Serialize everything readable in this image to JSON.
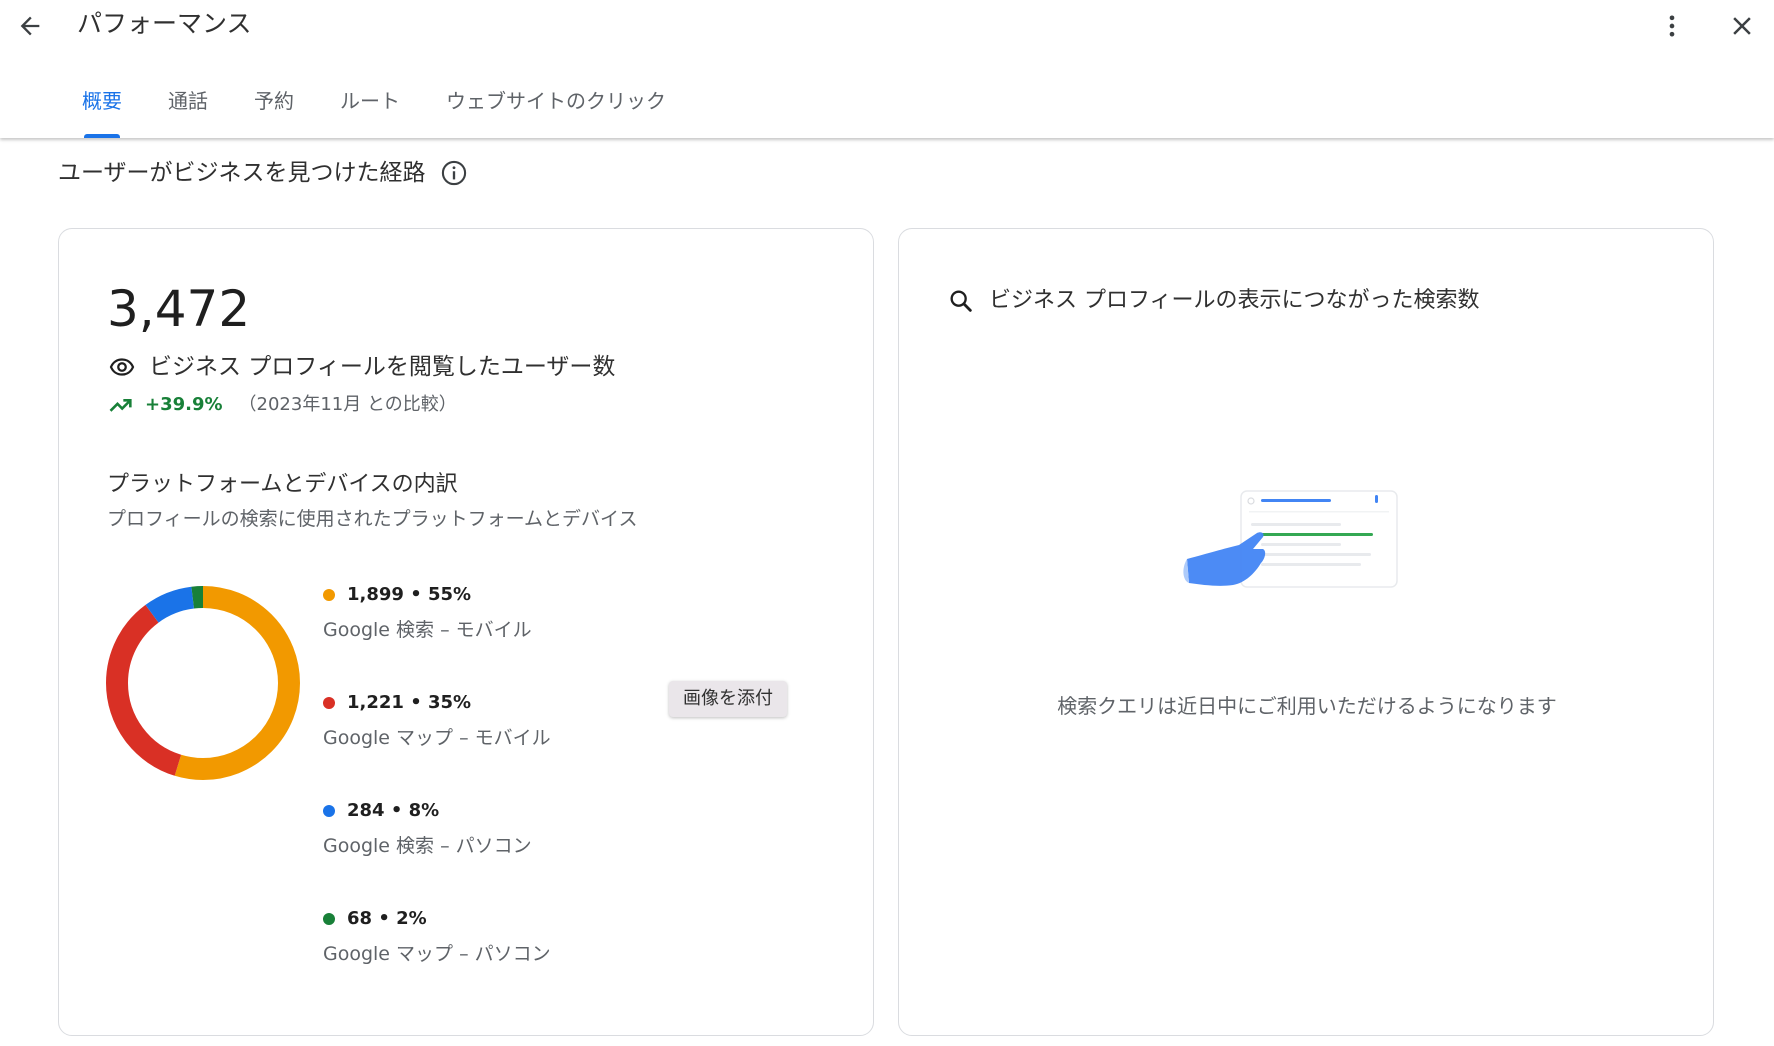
{
  "header": {
    "title": "パフォーマンス",
    "icons": {
      "back": "arrow-back-icon",
      "more": "more-vert-icon",
      "close": "close-icon"
    }
  },
  "tabs": [
    {
      "label": "概要",
      "active": true
    },
    {
      "label": "通話",
      "active": false
    },
    {
      "label": "予約",
      "active": false
    },
    {
      "label": "ルート",
      "active": false
    },
    {
      "label": "ウェブサイトのクリック",
      "active": false
    }
  ],
  "section": {
    "title": "ユーザーがビジネスを見つけた経路",
    "info_icon": "info-icon"
  },
  "left_card": {
    "total": "3,472",
    "total_label": "ビジネス プロフィールを閲覧したユーザー数",
    "trend_value": "+39.9%",
    "trend_compare": "（2023年11月 との比較）",
    "breakdown_title": "プラットフォームとデバイスの内訳",
    "breakdown_subtitle": "プロフィールの検索に使用されたプラットフォームとデバイス",
    "tooltip": "画像を添付"
  },
  "chart_data": {
    "type": "pie",
    "style": "donut",
    "series": [
      {
        "value_label": "1,899 • 55%",
        "value": 1899,
        "percent": 55,
        "label": "Google 検索 – モバイル",
        "color": "#f29900"
      },
      {
        "value_label": "1,221 • 35%",
        "value": 1221,
        "percent": 35,
        "label": "Google マップ – モバイル",
        "color": "#d93025"
      },
      {
        "value_label": "284 • 8%",
        "value": 284,
        "percent": 8,
        "label": "Google 検索 – パソコン",
        "color": "#1a73e8"
      },
      {
        "value_label": "68 • 2%",
        "value": 68,
        "percent": 2,
        "label": "Google マップ – パソコン",
        "color": "#188038"
      }
    ]
  },
  "right_card": {
    "title": "ビジネス プロフィールの表示につながった検索数",
    "message": "検索クエリは近日中にご利用いただけるようになります"
  },
  "colors": {
    "accent": "#1a73e8",
    "positive": "#188038"
  }
}
